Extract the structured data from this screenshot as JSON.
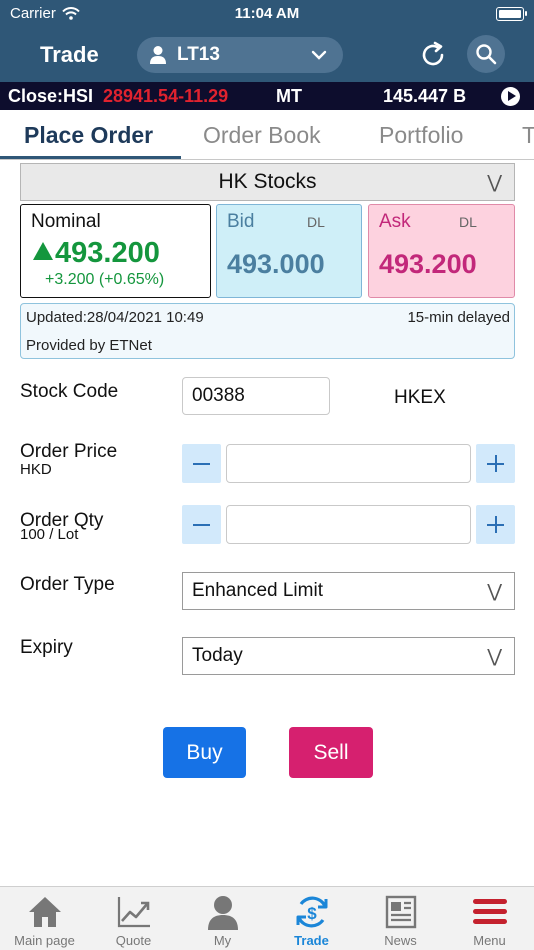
{
  "status_bar": {
    "carrier": "Carrier",
    "time": "11:04 AM"
  },
  "nav": {
    "title": "Trade",
    "account": "LT13"
  },
  "ticker": {
    "label": "Close:HSI",
    "value": "28941.54-11.29",
    "market": "MT",
    "turnover": "145.447 B"
  },
  "tabs": [
    "Place Order",
    "Order Book",
    "Portfolio",
    "T"
  ],
  "market_select": {
    "value": "HK Stocks"
  },
  "quote": {
    "nominal": {
      "label": "Nominal",
      "price": "493.200",
      "change": "+3.200 (+0.65%)"
    },
    "bid": {
      "label": "Bid",
      "tag": "DL",
      "price": "493.000"
    },
    "ask": {
      "label": "Ask",
      "tag": "DL",
      "price": "493.200"
    },
    "updated": "Updated:28/04/2021 10:49",
    "delay": "15-min delayed",
    "provider": "Provided by ETNet"
  },
  "form": {
    "stock_code": {
      "label": "Stock Code",
      "value": "00388",
      "exchange": "HKEX"
    },
    "order_price": {
      "label": "Order Price",
      "sub": "HKD",
      "value": ""
    },
    "order_qty": {
      "label": "Order Qty",
      "sub": "100 / Lot",
      "value": ""
    },
    "order_type": {
      "label": "Order Type",
      "value": "Enhanced Limit"
    },
    "expiry": {
      "label": "Expiry",
      "value": "Today"
    }
  },
  "actions": {
    "buy": "Buy",
    "sell": "Sell"
  },
  "tabbar": [
    {
      "label": "Main page",
      "icon": "home-icon"
    },
    {
      "label": "Quote",
      "icon": "chart-icon"
    },
    {
      "label": "My",
      "icon": "person-icon"
    },
    {
      "label": "Trade",
      "icon": "trade-icon",
      "active": true
    },
    {
      "label": "News",
      "icon": "news-icon"
    },
    {
      "label": "Menu",
      "icon": "menu-icon"
    }
  ],
  "colors": {
    "header": "#2f5777",
    "up": "#14963d",
    "down": "#e0222e",
    "buy": "#1672e6",
    "sell": "#d6206f",
    "active_tab": "#1b86d8"
  }
}
